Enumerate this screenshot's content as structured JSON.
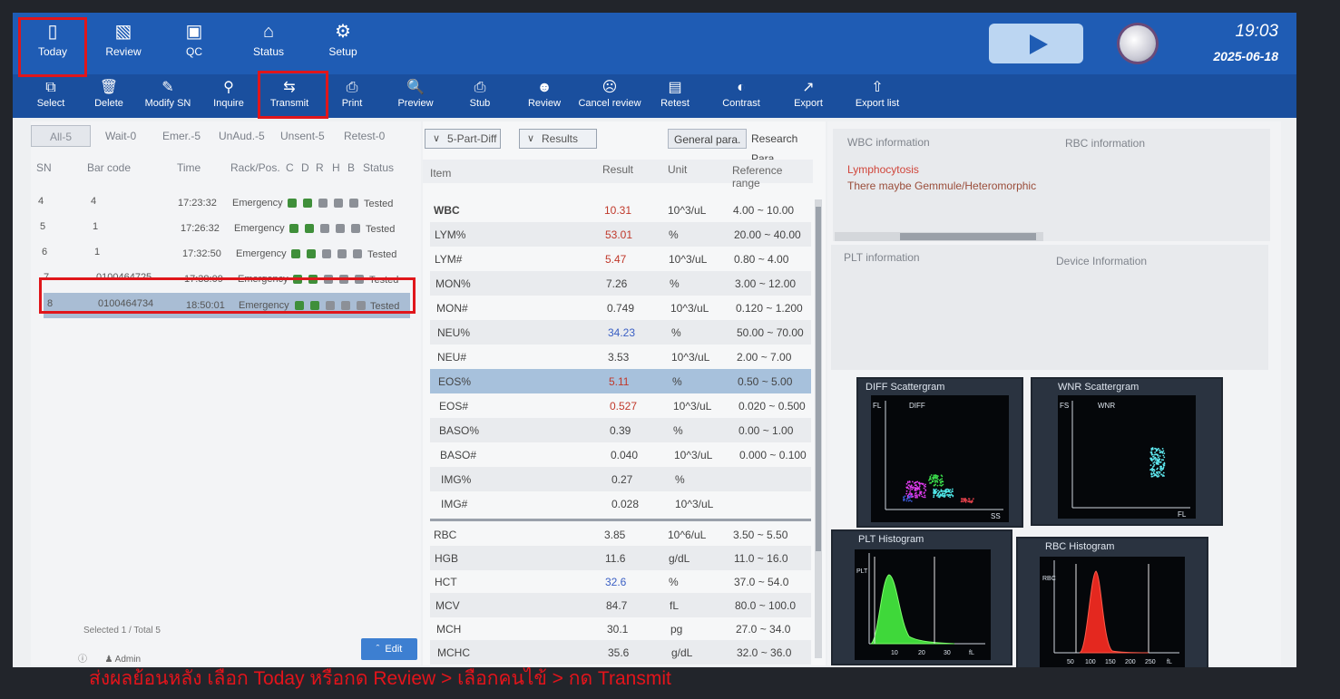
{
  "nav": [
    {
      "label": "Today",
      "icon": "test-tube-icon"
    },
    {
      "label": "Review",
      "icon": "bar-chart-icon"
    },
    {
      "label": "QC",
      "icon": "qc-monitor-icon"
    },
    {
      "label": "Status",
      "icon": "home-icon"
    },
    {
      "label": "Setup",
      "icon": "gear-icon"
    }
  ],
  "clock": {
    "time": "19:03",
    "date": "2025-06-18"
  },
  "toolbar": [
    {
      "label": "Select",
      "icon": "select-icon"
    },
    {
      "label": "Delete",
      "icon": "trash-icon"
    },
    {
      "label": "Modify SN",
      "icon": "modify-icon"
    },
    {
      "label": "Inquire",
      "icon": "search-icon"
    },
    {
      "label": "Transmit",
      "icon": "transmit-arrows-icon"
    },
    {
      "label": "Print",
      "icon": "printer-icon"
    },
    {
      "label": "Preview",
      "icon": "preview-icon"
    },
    {
      "label": "Stub",
      "icon": "stub-printer-icon"
    },
    {
      "label": "Review",
      "icon": "user-review-icon"
    },
    {
      "label": "Cancel review",
      "icon": "user-cancel-icon"
    },
    {
      "label": "Retest",
      "icon": "retest-icon"
    },
    {
      "label": "Contrast",
      "icon": "contrast-icon"
    },
    {
      "label": "Export",
      "icon": "export-icon"
    },
    {
      "label": "Export list",
      "icon": "upload-icon"
    }
  ],
  "filters": [
    "All-5",
    "Wait-0",
    "Emer.-5",
    "UnAud.-5",
    "Unsent-5",
    "Retest-0"
  ],
  "sample_table": {
    "headers": [
      "SN",
      "Bar code",
      "Time",
      "Rack/Pos.",
      "C",
      "D",
      "R",
      "H",
      "B",
      "Status"
    ],
    "rows": [
      {
        "sn": "4",
        "barcode": "4",
        "time": "17:23:32",
        "rack": "Emergency",
        "status": "Tested"
      },
      {
        "sn": "5",
        "barcode": "1",
        "time": "17:26:32",
        "rack": "Emergency",
        "status": "Tested"
      },
      {
        "sn": "6",
        "barcode": "1",
        "time": "17:32:50",
        "rack": "Emergency",
        "status": "Tested"
      },
      {
        "sn": "7",
        "barcode": "0100464725",
        "time": "17:38:09",
        "rack": "Emergency",
        "status": "Tested"
      },
      {
        "sn": "8",
        "barcode": "0100464734",
        "time": "18:50:01",
        "rack": "Emergency",
        "status": "Tested"
      }
    ]
  },
  "left_footer": {
    "selected": "Selected 1",
    "total": "Total 5",
    "edit": "Edit",
    "user": "Admin"
  },
  "mid_controls": {
    "mode": "5-Part-Diff",
    "view": "Results",
    "tab1": "General para.",
    "tab2": "Research Para."
  },
  "results": {
    "headers": [
      "Item",
      "Result",
      "Unit",
      "Reference range"
    ],
    "wbc": [
      {
        "item": "WBC",
        "result": "10.31",
        "unit": "10^3/uL",
        "range": "4.00 ~ 10.00",
        "flag": "high"
      },
      {
        "item": "LYM%",
        "result": "53.01",
        "unit": "%",
        "range": "20.00 ~ 40.00",
        "flag": "high"
      },
      {
        "item": "LYM#",
        "result": "5.47",
        "unit": "10^3/uL",
        "range": "0.80 ~ 4.00",
        "flag": "high"
      },
      {
        "item": "MON%",
        "result": "7.26",
        "unit": "%",
        "range": "3.00 ~ 12.00",
        "flag": ""
      },
      {
        "item": "MON#",
        "result": "0.749",
        "unit": "10^3/uL",
        "range": "0.120 ~ 1.200",
        "flag": ""
      },
      {
        "item": "NEU%",
        "result": "34.23",
        "unit": "%",
        "range": "50.00 ~ 70.00",
        "flag": "low"
      },
      {
        "item": "NEU#",
        "result": "3.53",
        "unit": "10^3/uL",
        "range": "2.00 ~ 7.00",
        "flag": ""
      },
      {
        "item": "EOS%",
        "result": "5.11",
        "unit": "%",
        "range": "0.50 ~ 5.00",
        "flag": "high"
      },
      {
        "item": "EOS#",
        "result": "0.527",
        "unit": "10^3/uL",
        "range": "0.020 ~ 0.500",
        "flag": "high"
      },
      {
        "item": "BASO%",
        "result": "0.39",
        "unit": "%",
        "range": "0.00 ~ 1.00",
        "flag": ""
      },
      {
        "item": "BASO#",
        "result": "0.040",
        "unit": "10^3/uL",
        "range": "0.000 ~ 0.100",
        "flag": ""
      },
      {
        "item": "IMG%",
        "result": "0.27",
        "unit": "%",
        "range": "",
        "flag": ""
      },
      {
        "item": "IMG#",
        "result": "0.028",
        "unit": "10^3/uL",
        "range": "",
        "flag": ""
      }
    ],
    "rbc": [
      {
        "item": "RBC",
        "result": "3.85",
        "unit": "10^6/uL",
        "range": "3.50 ~ 5.50",
        "flag": ""
      },
      {
        "item": "HGB",
        "result": "11.6",
        "unit": "g/dL",
        "range": "11.0 ~ 16.0",
        "flag": ""
      },
      {
        "item": "HCT",
        "result": "32.6",
        "unit": "%",
        "range": "37.0 ~ 54.0",
        "flag": "low"
      },
      {
        "item": "MCV",
        "result": "84.7",
        "unit": "fL",
        "range": "80.0 ~ 100.0",
        "flag": ""
      },
      {
        "item": "MCH",
        "result": "30.1",
        "unit": "pg",
        "range": "27.0 ~ 34.0",
        "flag": ""
      },
      {
        "item": "MCHC",
        "result": "35.6",
        "unit": "g/dL",
        "range": "32.0 ~ 36.0",
        "flag": ""
      }
    ]
  },
  "info": {
    "wbc_title": "WBC information",
    "rbc_title": "RBC information",
    "wbc_msg1": "Lymphocytosis",
    "wbc_msg2": "There maybe Gemmule/Heteromorphic",
    "plt_title": "PLT information",
    "device_title": "Device Information"
  },
  "plots": {
    "diff": {
      "title": "DIFF Scattergram",
      "inner": "DIFF",
      "y": "FL",
      "x": "SS"
    },
    "wnr": {
      "title": "WNR Scattergram",
      "inner": "WNR",
      "y": "FS",
      "x": "FL"
    },
    "plt": {
      "title": "PLT Histogram",
      "y": "PLT",
      "x_ticks": [
        "10",
        "20",
        "30"
      ],
      "x": "fL"
    },
    "rbc": {
      "title": "RBC Histogram",
      "y": "RBC",
      "x_ticks": [
        "50",
        "100",
        "150",
        "200",
        "250"
      ],
      "x": "fL"
    }
  },
  "colors": {
    "flag_high": "#c0392b",
    "flag_low": "#3a5fc4",
    "brand": "#1f5cb4",
    "highlight": "#e0161b"
  },
  "caption": "ส่งผลย้อนหลัง เลือก Today  หรือกด Review > เลือกคนไข้ > กด Transmit"
}
